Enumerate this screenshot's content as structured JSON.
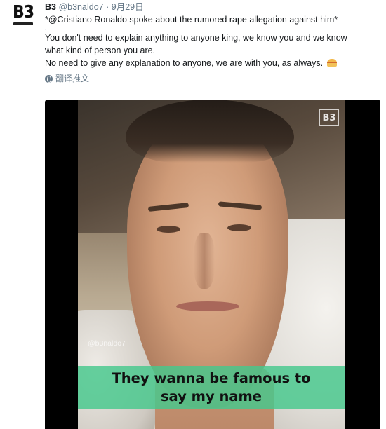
{
  "account": {
    "logo_text": "B3",
    "name": "B3",
    "handle": "@b3naldo7",
    "separator": "·",
    "date": "9月29日"
  },
  "tweet": {
    "line1": "*@Cristiano Ronaldo spoke about the rumored rape allegation against him*",
    "spacer": ".",
    "line2": "You don't need to explain anything to anyone king, we know you and we know",
    "line3": "what kind of person you are.",
    "line4": "No need to give any explanation to anyone, we are with you, as always.",
    "emoji": "burger-emoji"
  },
  "translate": {
    "icon": "globe-icon",
    "label": "翻译推文"
  },
  "video": {
    "watermark_logo": "B3",
    "watermark_handle": "@b3naldo7",
    "caption_line1": "They wanna be famous to",
    "caption_line2": "say my name",
    "caption_color": "#46c88c"
  }
}
